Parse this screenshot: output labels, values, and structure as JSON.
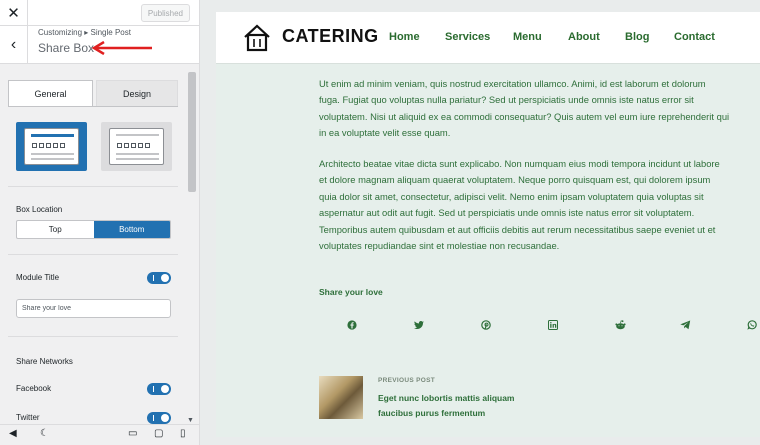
{
  "customizer": {
    "close_icon": "close-icon",
    "published_label": "Published",
    "breadcrumb": "Customizing ▸ Single Post",
    "section_title": "Share Box",
    "tabs": [
      {
        "label": "General",
        "active": true
      },
      {
        "label": "Design",
        "active": false
      }
    ],
    "box_location": {
      "label": "Box Location",
      "options": [
        "Top",
        "Bottom"
      ],
      "selected": "Bottom"
    },
    "module_title": {
      "label": "Module Title",
      "enabled": true,
      "input_value": "Share your love"
    },
    "share_networks": {
      "label": "Share Networks",
      "items": [
        {
          "label": "Facebook",
          "enabled": true
        },
        {
          "label": "Twitter",
          "enabled": true
        }
      ]
    },
    "footer_icons": [
      "collapse-icon",
      "dark-mode-icon",
      "desktop-icon",
      "tablet-icon",
      "mobile-icon"
    ],
    "accent_color": "#2271b1"
  },
  "site": {
    "logo_text": "CATERING",
    "nav": [
      "Home",
      "Services",
      "Menu",
      "About",
      "Blog",
      "Contact"
    ],
    "paragraphs": [
      [
        "Ut enim ad minim veniam, quis nostrud exercitation ullamco. Animi, id est laborum et dolorum",
        "fuga. Fugiat quo voluptas nulla pariatur? Sed ut perspiciatis unde omnis iste natus error sit",
        "voluptatem. Nisi ut aliquid ex ea commodi consequatur? Quis autem vel eum iure reprehenderit qui",
        "in ea voluptate velit esse quam."
      ],
      [
        "Architecto beatae vitae dicta sunt explicabo. Non numquam eius modi tempora incidunt ut labore",
        "et dolore magnam aliquam quaerat voluptatem. Neque porro quisquam est, qui dolorem ipsum",
        "quia dolor sit amet, consectetur, adipisci velit. Nemo enim ipsam voluptatem quia voluptas sit",
        "aspernatur aut odit aut fugit. Sed ut perspiciatis unde omnis iste natus error sit voluptatem.",
        "Temporibus autem quibusdam et aut officiis debitis aut rerum necessitatibus saepe eveniet ut et",
        "voluptates repudiandae sint et molestiae non recusandae."
      ]
    ],
    "share_title": "Share your love",
    "share_icons": [
      "facebook-icon",
      "twitter-icon",
      "pinterest-icon",
      "linkedin-icon",
      "reddit-icon",
      "telegram-icon",
      "whatsapp-icon"
    ],
    "prev_post": {
      "label": "PREVIOUS POST",
      "title_lines": [
        "Eget nunc lobortis mattis aliquam",
        "faucibus purus fermentum"
      ]
    },
    "text_color": "#2e6f3a"
  }
}
